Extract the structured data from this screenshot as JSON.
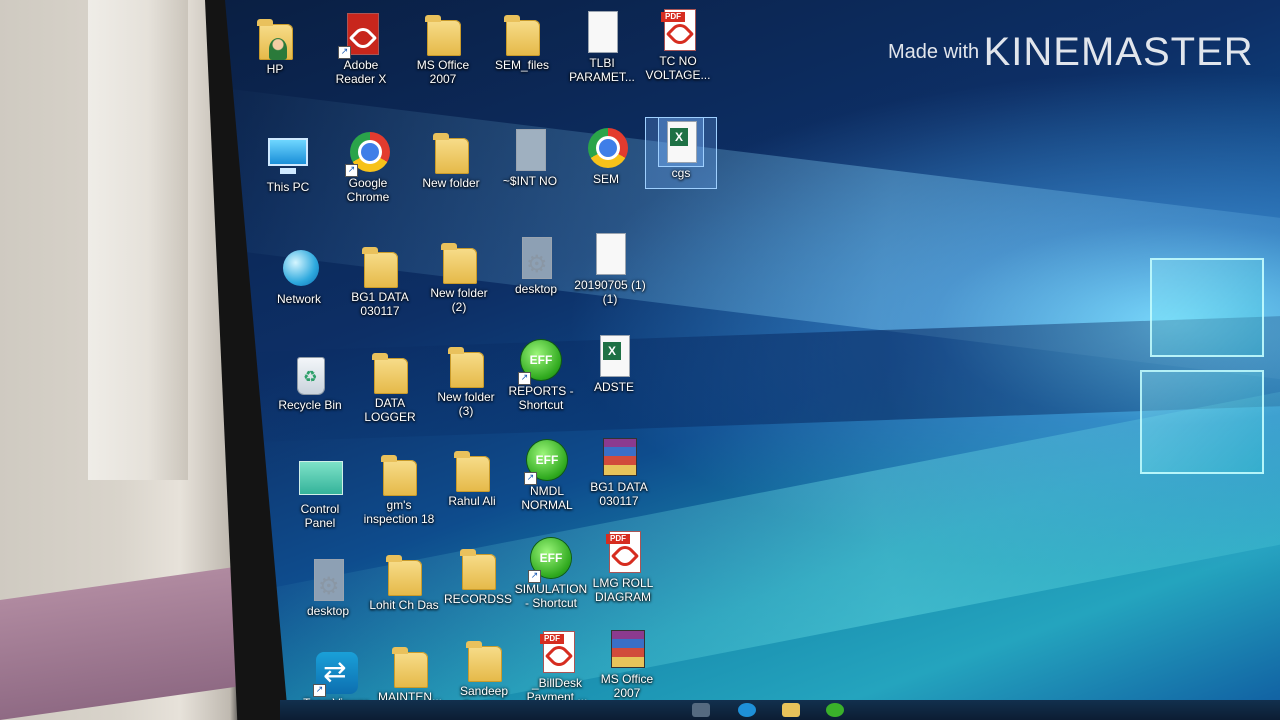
{
  "watermark": {
    "prefix": "Made with",
    "brand": "KINEMASTER"
  },
  "icons": [
    {
      "key": "hp",
      "label": "HP",
      "type": "folder-user"
    },
    {
      "key": "adobe",
      "label": "Adobe\nReader X",
      "type": "pdf-app"
    },
    {
      "key": "msoffice",
      "label": "MS Office\n2007",
      "type": "folder"
    },
    {
      "key": "semfiles",
      "label": "SEM_files",
      "type": "folder"
    },
    {
      "key": "tlbi",
      "label": "TLBI\nPARAMET...",
      "type": "doc"
    },
    {
      "key": "tcno",
      "label": "TC NO\nVOLTAGE...",
      "type": "pdf"
    },
    {
      "key": "thispc",
      "label": "This PC",
      "type": "pc"
    },
    {
      "key": "chrome",
      "label": "Google\nChrome",
      "type": "chrome"
    },
    {
      "key": "newfolder",
      "label": "New folder",
      "type": "folder"
    },
    {
      "key": "sintno",
      "label": "~$INT NO",
      "type": "doc"
    },
    {
      "key": "sem",
      "label": "SEM",
      "type": "chrome"
    },
    {
      "key": "cgs",
      "label": "cgs",
      "type": "excel",
      "selected": true
    },
    {
      "key": "network",
      "label": "Network",
      "type": "globe"
    },
    {
      "key": "bg1data",
      "label": "BG1 DATA\n030117",
      "type": "folder"
    },
    {
      "key": "newfolder2",
      "label": "New folder\n(2)",
      "type": "folder"
    },
    {
      "key": "desktop1",
      "label": "desktop",
      "type": "cog"
    },
    {
      "key": "file20190705",
      "label": "20190705 (1)\n(1)",
      "type": "doc"
    },
    {
      "key": "recycle",
      "label": "Recycle Bin",
      "type": "bin"
    },
    {
      "key": "datalogger",
      "label": "DATA\nLOGGER",
      "type": "folder"
    },
    {
      "key": "newfolder3",
      "label": "New folder\n(3)",
      "type": "folder"
    },
    {
      "key": "reports",
      "label": "REPORTS -\nShortcut",
      "type": "eff"
    },
    {
      "key": "adste",
      "label": "ADSTE",
      "type": "excel"
    },
    {
      "key": "cpanel",
      "label": "Control\nPanel",
      "type": "cpanel"
    },
    {
      "key": "gms",
      "label": "gm's\ninspection 18",
      "type": "folder"
    },
    {
      "key": "rahul",
      "label": "Rahul Ali",
      "type": "folder"
    },
    {
      "key": "nmdl",
      "label": "NMDL\nNORMAL",
      "type": "eff"
    },
    {
      "key": "bg1rar",
      "label": "BG1 DATA\n030117",
      "type": "rar"
    },
    {
      "key": "desktop2",
      "label": "desktop",
      "type": "cog"
    },
    {
      "key": "lohit",
      "label": "Lohit Ch Das",
      "type": "folder"
    },
    {
      "key": "recordss",
      "label": "RECORDSS",
      "type": "folder"
    },
    {
      "key": "simulation",
      "label": "SIMULATION\n- Shortcut",
      "type": "eff"
    },
    {
      "key": "lmgroll",
      "label": "LMG ROLL\nDIAGRAM",
      "type": "pdf"
    },
    {
      "key": "teamviewer",
      "label": "TeamViewer",
      "type": "tv"
    },
    {
      "key": "mainten",
      "label": "MAINTEN...",
      "type": "folder"
    },
    {
      "key": "sandeep",
      "label": "Sandeep\nBarman",
      "type": "folder"
    },
    {
      "key": "billdesk",
      "label": "_BillDesk\nPayment ...",
      "type": "pdf"
    },
    {
      "key": "msoffice2",
      "label": "MS Office\n2007",
      "type": "rar"
    }
  ],
  "eff_text": "EFF",
  "pdf_tag": "PDF",
  "excel_mark": "X"
}
